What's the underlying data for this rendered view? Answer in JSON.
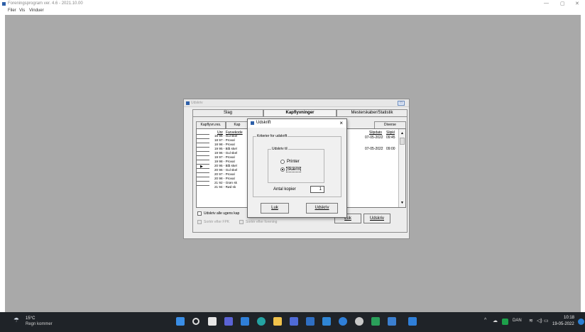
{
  "window": {
    "title": "Foreningsprogram ver. 4.6 - 2021.10.00",
    "minimize_glyph": "—",
    "maximize_glyph": "▢",
    "close_glyph": "✕"
  },
  "menubar": {
    "items": [
      "Filer",
      "Vis",
      "Vinduer"
    ]
  },
  "bg_dialog": {
    "title": "Udskriv",
    "top_tabs": [
      "Slag",
      "Kapflyvninger",
      "Mesterskaber/Statistik"
    ],
    "sub_tabs": [
      "Kapflyvn.res.",
      "Kap",
      "Diverse"
    ],
    "grid_headers": {
      "col1": "Unr",
      "col2": "Farvekode",
      "col3": "Slipdato",
      "col4": "Slipkl"
    },
    "rows": [
      "18 96 - Gul skel",
      "18 97 - Proval",
      "18 98 - Proval",
      "19 95 - Blå skel",
      "19 96 - Gul skel",
      "19 97 - Proval",
      "19 98 - Proval",
      "20 95 - Blå skel",
      "20 96 - Gul skel",
      "20 97 - Proval",
      "20 98 - Proval",
      "21 92 - Grøn sk",
      "21 94 - Rød sk"
    ],
    "right_rows": [
      {
        "date": "07-05-2022",
        "time": "09:45"
      },
      {
        "date": "07-05-2022",
        "time": "09:00"
      }
    ],
    "checkbox_all": "Udskriv alle ugens kap",
    "checkbox_fpk": "Sortér efter FPK",
    "checkbox_forening": "Sortér efter forening",
    "btn_luk": "Luk",
    "btn_udskriv": "Udskriv"
  },
  "modal": {
    "title": "Udskrift",
    "group_outer": "Kriterier for udskrift",
    "group_inner": "Udskriv til",
    "radio_printer": "Printer",
    "radio_skaerm": "Skærm",
    "copies_label": "Antal kopier",
    "copies_value": "1",
    "btn_luk": "Luk",
    "btn_udskriv": "Udskriv"
  },
  "taskbar": {
    "weather_temp": "15°C",
    "weather_desc": "Regn kommer",
    "language": "DAN",
    "time": "10:18",
    "date": "19-05-2022"
  },
  "colors": {
    "workspace": "#a9a9a9",
    "taskbar": "#1f2328",
    "accent": "#2d5fa8"
  }
}
